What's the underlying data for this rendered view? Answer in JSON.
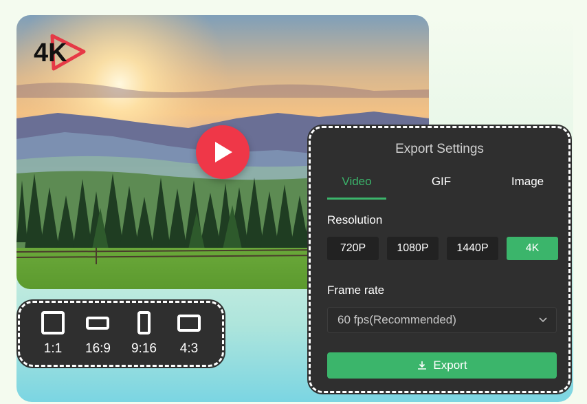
{
  "logo": {
    "text": "4K"
  },
  "aspect_ratios": [
    {
      "label": "1:1",
      "icon": "square-icon"
    },
    {
      "label": "16:9",
      "icon": "landscape-icon"
    },
    {
      "label": "9:16",
      "icon": "portrait-icon"
    },
    {
      "label": "4:3",
      "icon": "standard-icon"
    }
  ],
  "export_panel": {
    "title": "Export Settings",
    "tabs": [
      {
        "label": "Video",
        "active": true
      },
      {
        "label": "GIF",
        "active": false
      },
      {
        "label": "Image",
        "active": false
      }
    ],
    "resolution_label": "Resolution",
    "resolutions": [
      {
        "label": "720P",
        "active": false
      },
      {
        "label": "1080P",
        "active": false
      },
      {
        "label": "1440P",
        "active": false
      },
      {
        "label": "4K",
        "active": true
      }
    ],
    "frame_rate_label": "Frame rate",
    "frame_rate_value": "60 fps(Recommended)",
    "export_label": "Export"
  },
  "colors": {
    "accent": "#3bb56b",
    "panel": "#2f2f2f",
    "play": "#ef3748"
  }
}
